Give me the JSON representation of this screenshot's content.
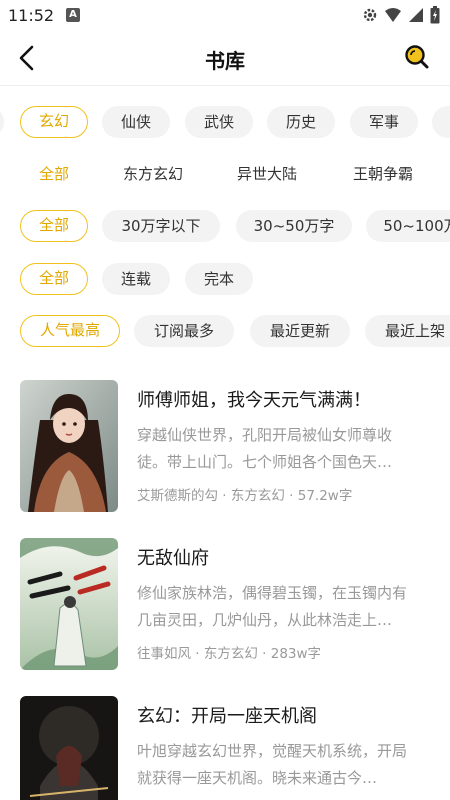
{
  "status_bar": {
    "time": "11:52",
    "notification_icon": "A",
    "icons": [
      "settings-icon",
      "wifi-icon",
      "signal-icon",
      "battery-icon"
    ]
  },
  "header": {
    "title": "书库",
    "back_icon": "chevron-left-icon",
    "search_icon": "search-icon"
  },
  "filters": {
    "category": [
      "",
      "玄幻",
      "仙侠",
      "武侠",
      "历史",
      "军事",
      ""
    ],
    "category_selected": "玄幻",
    "subcategory": [
      "全部",
      "东方玄幻",
      "异世大陆",
      "王朝争霸"
    ],
    "subcategory_selected": "全部",
    "word_count": [
      "全部",
      "30万字以下",
      "30~50万字",
      "50~100万"
    ],
    "word_count_selected": "全部",
    "status": [
      "全部",
      "连载",
      "完本"
    ],
    "status_selected": "全部",
    "sort": [
      "人气最高",
      "订阅最多",
      "最近更新",
      "最近上架"
    ],
    "sort_selected": "人气最高"
  },
  "books": [
    {
      "title": "师傅师姐，我今天元气满满！",
      "desc": "穿越仙侠世界，孔阳开局被仙女师尊收徒。带上山门。七个师姐各个国色天…",
      "meta": "艾斯德斯的勾 · 东方玄幻 · 57.2w字"
    },
    {
      "title": "无敌仙府",
      "desc": "修仙家族林浩，偶得碧玉镯，在玉镯内有几亩灵田，几炉仙丹，从此林浩走上…",
      "meta": "往事如风 · 东方玄幻 · 283w字"
    },
    {
      "title": "玄幻：开局一座天机阁",
      "desc": "叶旭穿越玄幻世界，觉醒天机系统，开局就获得一座天机阁。晓未来通古今…",
      "meta": ""
    }
  ],
  "colors": {
    "accent": "#f2c21c",
    "accent_text": "#e0a800",
    "chip_bg": "#f3f3f3",
    "muted_text": "#999999"
  }
}
